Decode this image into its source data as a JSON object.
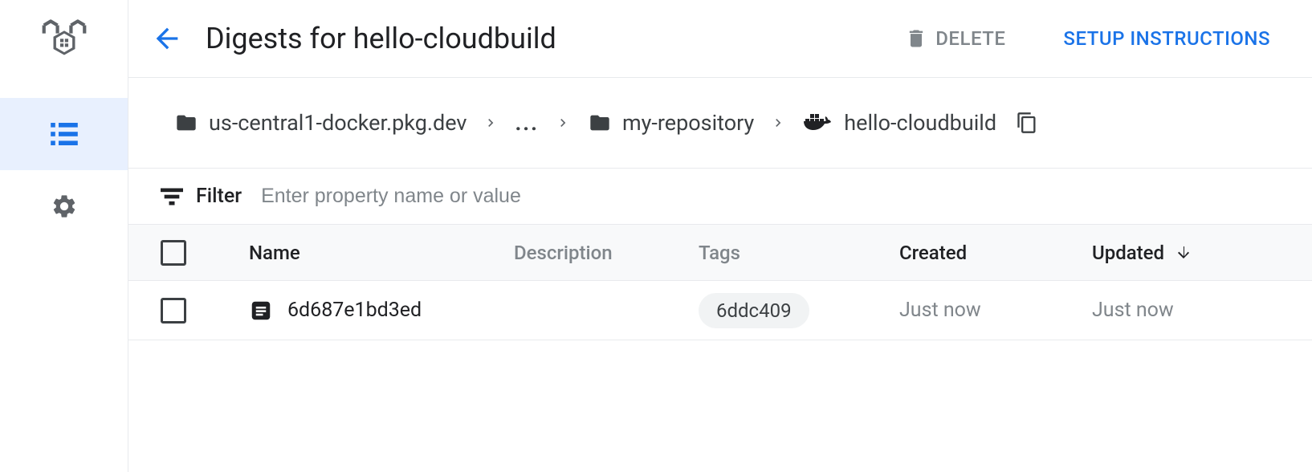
{
  "header": {
    "title": "Digests for hello-cloudbuild",
    "delete_label": "DELETE",
    "setup_label": "SETUP INSTRUCTIONS"
  },
  "breadcrumb": {
    "items": [
      {
        "label": "us-central1-docker.pkg.dev",
        "icon": "folder"
      },
      {
        "label": "...",
        "icon": "ellipsis"
      },
      {
        "label": "my-repository",
        "icon": "folder"
      },
      {
        "label": "hello-cloudbuild",
        "icon": "docker"
      }
    ]
  },
  "filter": {
    "label": "Filter",
    "placeholder": "Enter property name or value"
  },
  "table": {
    "columns": {
      "name": "Name",
      "description": "Description",
      "tags": "Tags",
      "created": "Created",
      "updated": "Updated"
    },
    "rows": [
      {
        "name": "6d687e1bd3ed",
        "description": "",
        "tag": "6ddc409",
        "created": "Just now",
        "updated": "Just now"
      }
    ]
  }
}
